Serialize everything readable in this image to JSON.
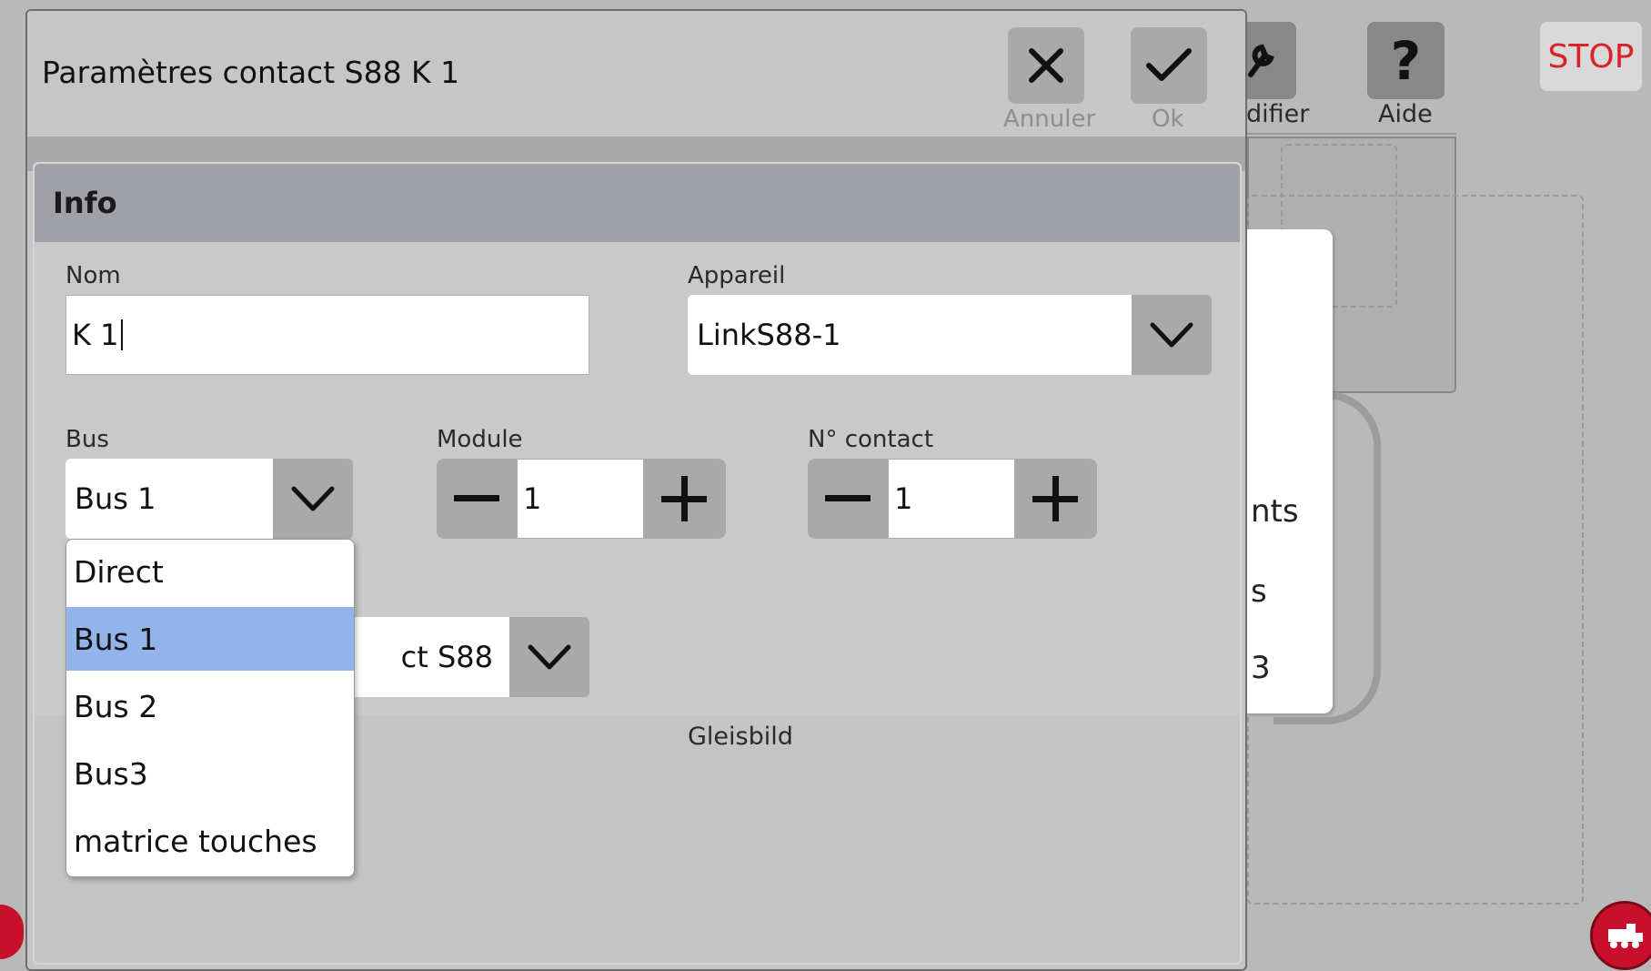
{
  "background": {
    "toolbar": {
      "modify_label": "difier",
      "help_label": "Aide",
      "stop_label": "STOP"
    },
    "menu_fragments": [
      "nts",
      "s",
      "3"
    ]
  },
  "dialog": {
    "title": "Paramètres contact S88 K 1",
    "cancel_label": "Annuler",
    "ok_label": "Ok",
    "section_title": "Info",
    "fields": {
      "name_label": "Nom",
      "name_value": "K 1",
      "device_label": "Appareil",
      "device_value": "LinkS88-1",
      "bus_label": "Bus",
      "bus_value": "Bus 1",
      "module_label": "Module",
      "module_value": "1",
      "contact_label": "N° contact",
      "contact_value": "1",
      "type_value": "ct S88",
      "footer_label": "Gleisbild"
    },
    "bus_options": [
      "Direct",
      "Bus 1",
      "Bus 2",
      "Bus3",
      "matrice touches"
    ],
    "bus_selected_index": 1
  },
  "colors": {
    "stop": "#d9232a",
    "selected_option": "#93b4ea",
    "loco_button": "#c8102e"
  }
}
